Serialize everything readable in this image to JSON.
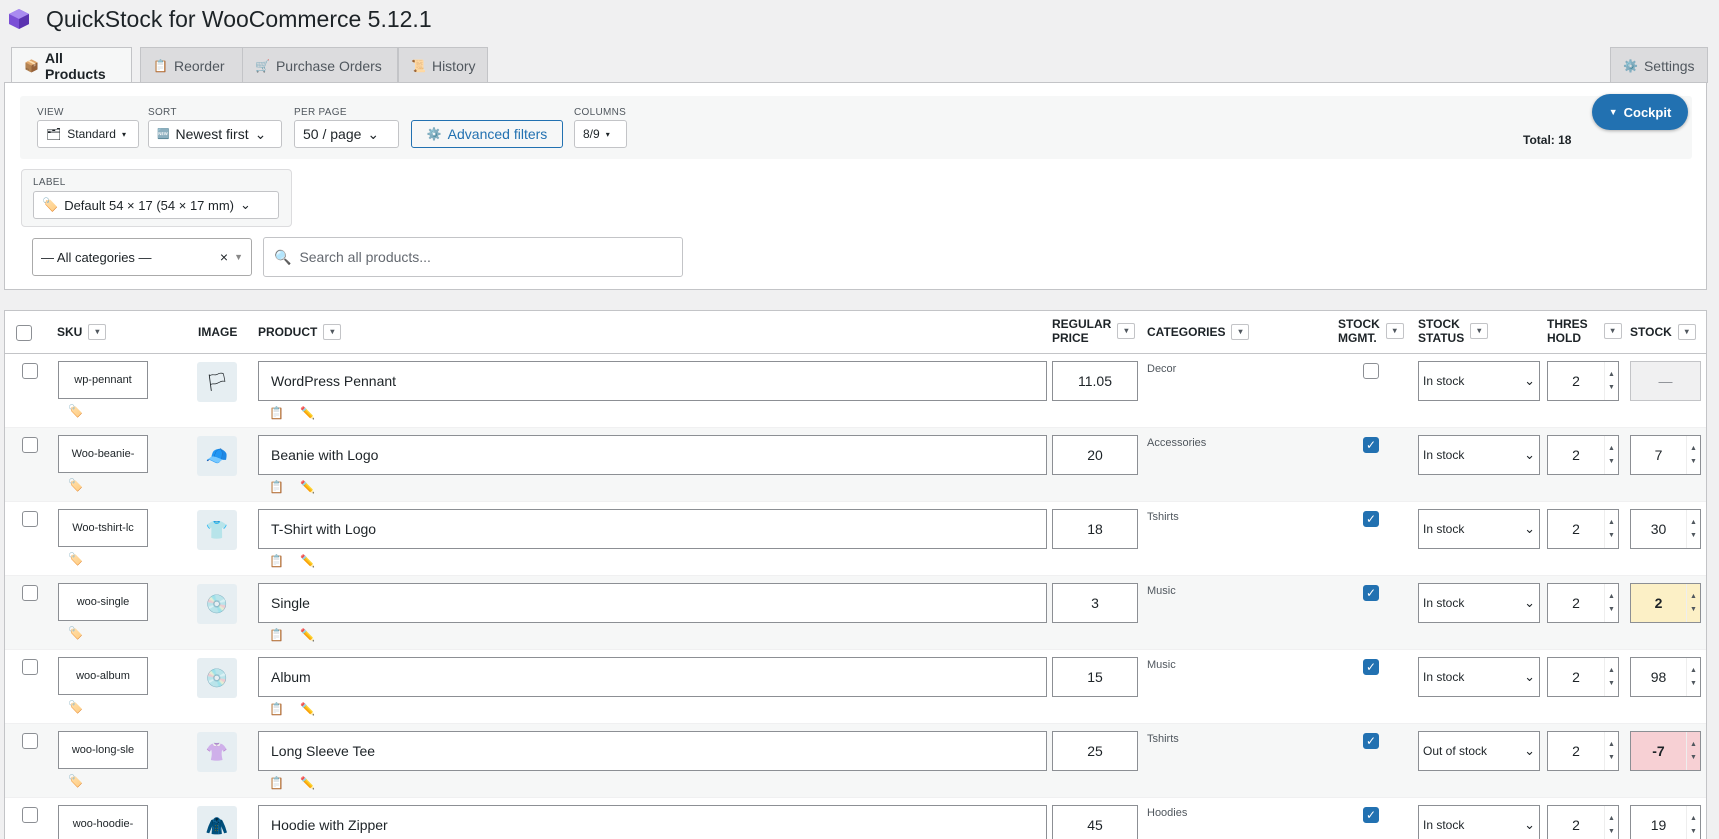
{
  "app": {
    "title": "QuickStock for WooCommerce 5.12.1",
    "logo": "box-logo"
  },
  "tabs": [
    {
      "label": "All Products",
      "icon": "📦"
    },
    {
      "label": "Reorder",
      "icon": "📋"
    },
    {
      "label": "Purchase Orders",
      "icon": "🛒"
    },
    {
      "label": "History",
      "icon": "📜"
    },
    {
      "label": "Settings",
      "icon": "⚙️"
    }
  ],
  "toolbar": {
    "view_label": "VIEW",
    "view_value": "Standard",
    "sort_label": "SORT",
    "sort_value": "Newest first",
    "per_page_label": "PER PAGE",
    "per_page_value": "50 / page",
    "advanced_filters": "Advanced filters",
    "columns_label": "COLUMNS",
    "columns_value": "8/9",
    "cockpit": "Cockpit",
    "total": "Total: 18"
  },
  "label": {
    "title": "LABEL",
    "value": "Default 54 × 17 (54 × 17 mm)"
  },
  "filters": {
    "category": "— All categories —",
    "search_placeholder": "Search all products..."
  },
  "columns": {
    "sku": "SKU",
    "image": "IMAGE",
    "product": "PRODUCT",
    "price_1": "REGULAR",
    "price_2": "PRICE",
    "categories": "CATEGORIES",
    "mgmt_1": "STOCK",
    "mgmt_2": "MGMT.",
    "status_1": "STOCK",
    "status_2": "STATUS",
    "thres_1": "THRES",
    "thres_2": "HOLD",
    "stock": "STOCK"
  },
  "rows": [
    {
      "sku": "wp-pennant",
      "image": "🏳",
      "name": "WordPress Pennant",
      "price": "11.05",
      "category": "Decor",
      "managed": false,
      "status": "In stock",
      "threshold": "2",
      "stock": "—",
      "stock_state": "none"
    },
    {
      "sku": "Woo-beanie-",
      "image": "🧢",
      "name": "Beanie with Logo",
      "price": "20",
      "category": "Accessories",
      "managed": true,
      "status": "In stock",
      "threshold": "2",
      "stock": "7",
      "stock_state": "normal"
    },
    {
      "sku": "Woo-tshirt-lc",
      "image": "👕",
      "name": "T-Shirt with Logo",
      "price": "18",
      "category": "Tshirts",
      "managed": true,
      "status": "In stock",
      "threshold": "2",
      "stock": "30",
      "stock_state": "normal"
    },
    {
      "sku": "woo-single",
      "image": "💿",
      "name": "Single",
      "price": "3",
      "category": "Music",
      "managed": true,
      "status": "In stock",
      "threshold": "2",
      "stock": "2",
      "stock_state": "low"
    },
    {
      "sku": "woo-album",
      "image": "💿",
      "name": "Album",
      "price": "15",
      "category": "Music",
      "managed": true,
      "status": "In stock",
      "threshold": "2",
      "stock": "98",
      "stock_state": "normal"
    },
    {
      "sku": "woo-long-sle",
      "image": "👚",
      "name": "Long Sleeve Tee",
      "price": "25",
      "category": "Tshirts",
      "managed": true,
      "status": "Out of stock",
      "threshold": "2",
      "stock": "-7",
      "stock_state": "negative"
    },
    {
      "sku": "woo-hoodie-",
      "image": "🧥",
      "name": "Hoodie with Zipper",
      "price": "45",
      "category": "Hoodies",
      "managed": true,
      "status": "In stock",
      "threshold": "2",
      "stock": "19",
      "stock_state": "normal"
    }
  ]
}
